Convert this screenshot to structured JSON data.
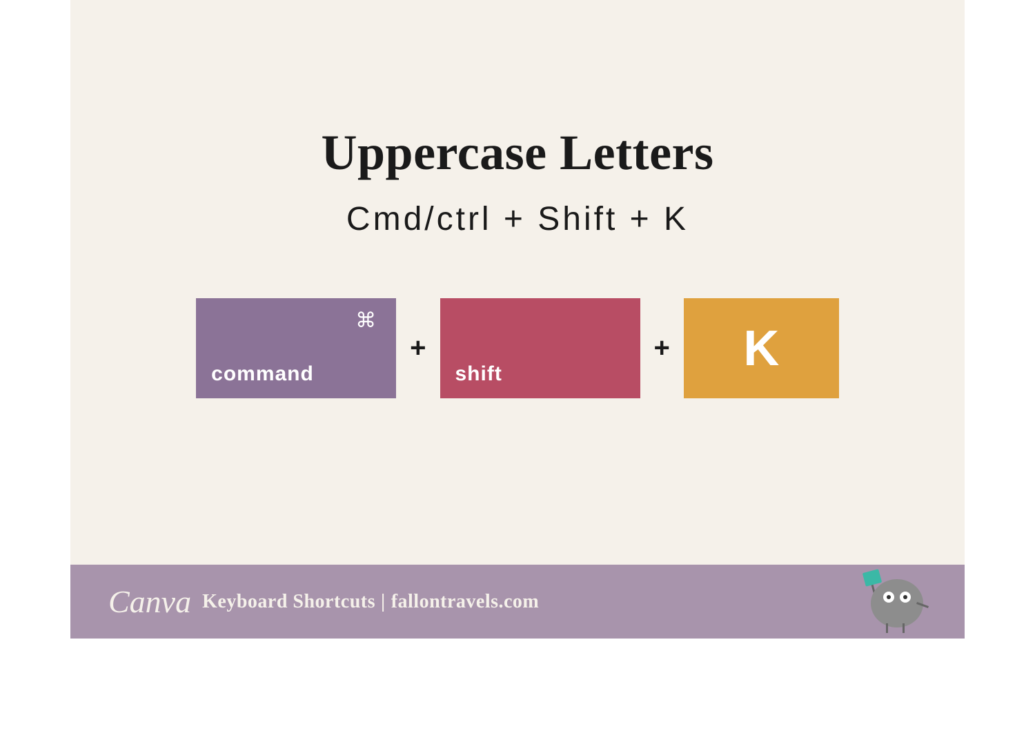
{
  "title": "Uppercase Letters",
  "subtitle": "Cmd/ctrl + Shift + K",
  "keys": {
    "command": {
      "label": "command",
      "symbol": "⌘"
    },
    "shift": {
      "label": "shift"
    },
    "k": {
      "label": "K"
    },
    "plus": "+"
  },
  "footer": {
    "logo": "Canva",
    "title": "Keyboard Shortcuts",
    "separator": "|",
    "site": "fallontravels.com"
  }
}
